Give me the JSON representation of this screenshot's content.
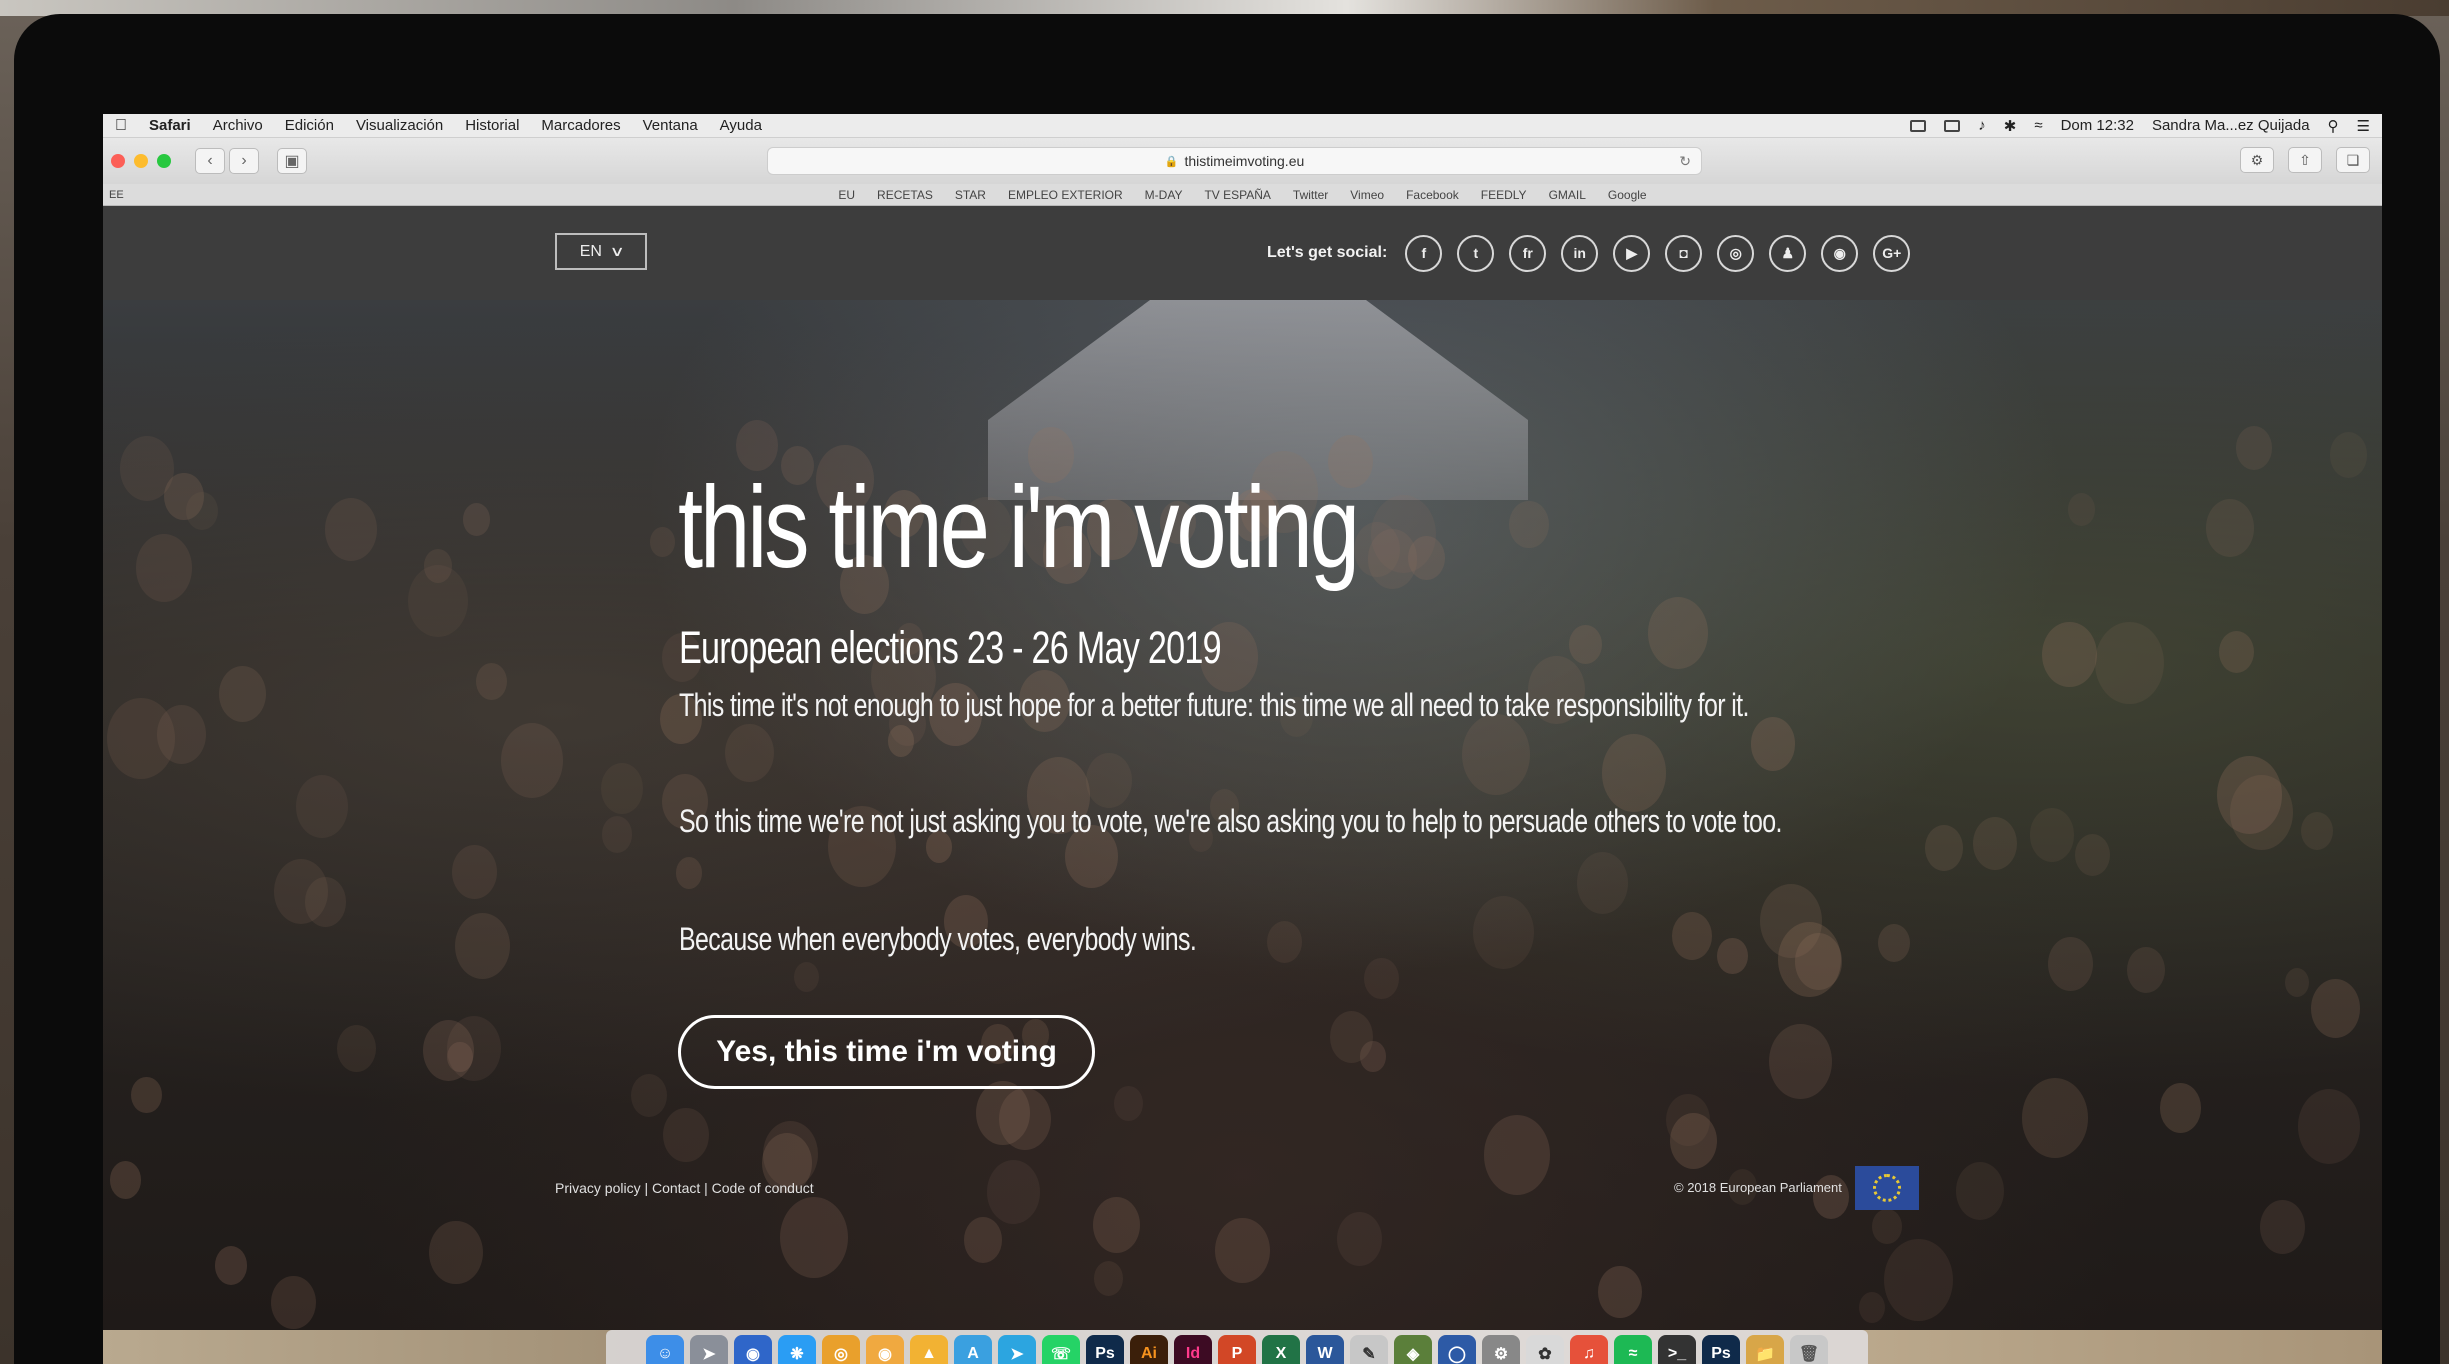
{
  "menubar": {
    "app_name": "Safari",
    "items": [
      "Archivo",
      "Edición",
      "Visualización",
      "Historial",
      "Marcadores",
      "Ventana",
      "Ayuda"
    ],
    "clock": "Dom 12:32",
    "user": "Sandra Ma...ez Quijada"
  },
  "browser": {
    "url": "thistimeimvoting.eu",
    "bookmarks_left": "EE",
    "bookmarks": [
      "EU",
      "RECETAS",
      "STAR",
      "EMPLEO EXTERIOR",
      "M-DAY",
      "TV ESPAÑA",
      "Twitter",
      "Vimeo",
      "Facebook",
      "FEEDLY",
      "GMAIL",
      "Google"
    ]
  },
  "header": {
    "language": "EN",
    "social_label": "Let's get social:",
    "social_icons": [
      "f",
      "t",
      "fr",
      "in",
      "▶",
      "◘",
      "◎",
      "♟",
      "◉",
      "G+"
    ]
  },
  "hero": {
    "title": "this time i'm voting",
    "subtitle": "European elections 23 - 26 May 2019",
    "paragraph_1": "This time it's not enough to just hope for a better future: this time we all need to take responsibility for it.",
    "paragraph_2": "So this time we're not just asking you to vote, we're also asking you to help to persuade others to vote too.",
    "paragraph_3": "Because when everybody votes, everybody wins.",
    "cta_label": "Yes, this time i'm voting"
  },
  "footer": {
    "links": "Privacy policy | Contact | Code of conduct",
    "copyright": "© 2018 European Parliament"
  },
  "dock": {
    "labels": [
      "Ps",
      "Ai",
      "Id",
      "X",
      "W",
      "Ps"
    ]
  },
  "colors": {
    "site_header_bg": "#3d3d3d",
    "eu_blue": "#2b4b9b",
    "eu_star": "#e8c935"
  }
}
